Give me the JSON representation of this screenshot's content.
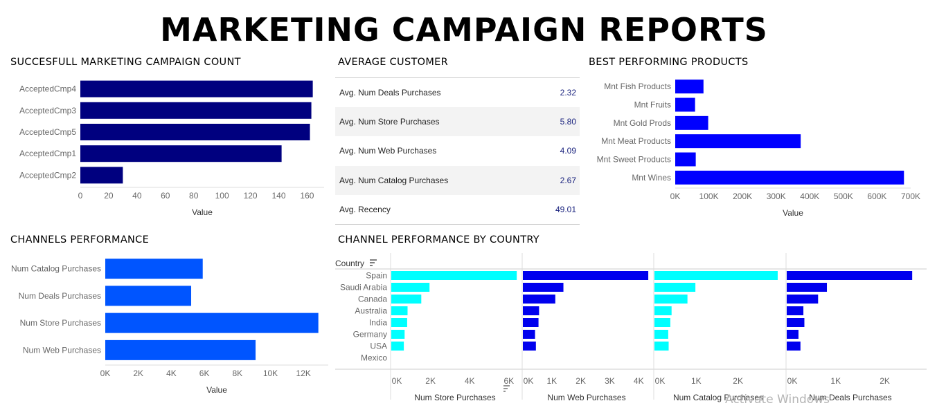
{
  "title": "MARKETING CAMPAIGN REPORTS",
  "sections": {
    "campaign": "SUCCESFULL MARKETING CAMPAIGN COUNT",
    "average": "AVERAGE CUSTOMER",
    "products": "BEST PERFORMING PRODUCTS",
    "channels": "CHANNELS PERFORMANCE",
    "country": "CHANNEL PERFORMANCE BY COUNTRY"
  },
  "average_customer": {
    "rows": [
      {
        "label": "Avg. Num Deals Purchases",
        "value": "2.32"
      },
      {
        "label": "Avg. Num Store Purchases",
        "value": "5.80"
      },
      {
        "label": "Avg. Num Web Purchases",
        "value": "4.09"
      },
      {
        "label": "Avg. Num Catalog Purchases",
        "value": "2.67"
      },
      {
        "label": "Avg. Recency",
        "value": "49.01"
      }
    ]
  },
  "colors": {
    "navy": "#00007f",
    "blue": "#0000ff",
    "mid_blue": "#0055ff",
    "cyan": "#00ffff"
  },
  "watermark": "Activate Windows",
  "chart_data": [
    {
      "type": "bar",
      "orientation": "horizontal",
      "title": "SUCCESFULL MARKETING CAMPAIGN COUNT",
      "categories": [
        "AcceptedCmp4",
        "AcceptedCmp3",
        "AcceptedCmp5",
        "AcceptedCmp1",
        "AcceptedCmp2"
      ],
      "values": [
        164,
        163,
        162,
        142,
        30
      ],
      "xlabel": "Value",
      "xlim": [
        0,
        172
      ],
      "ticks": [
        0,
        20,
        40,
        60,
        80,
        100,
        120,
        140,
        160
      ],
      "tick_labels": [
        "0",
        "20",
        "40",
        "60",
        "80",
        "100",
        "120",
        "140",
        "160"
      ],
      "color": "#00007f"
    },
    {
      "type": "bar",
      "orientation": "horizontal",
      "title": "BEST PERFORMING PRODUCTS",
      "categories": [
        "Mnt Fish Products",
        "Mnt Fruits",
        "Mnt Gold Prods",
        "Mnt Meat Products",
        "Mnt Sweet Products",
        "Mnt Wines"
      ],
      "values": [
        84000,
        59000,
        98000,
        373000,
        61000,
        680000
      ],
      "xlabel": "Value",
      "xlim": [
        0,
        700000
      ],
      "ticks": [
        0,
        100000,
        200000,
        300000,
        400000,
        500000,
        600000,
        700000
      ],
      "tick_labels": [
        "0K",
        "100K",
        "200K",
        "300K",
        "400K",
        "500K",
        "600K",
        "700K"
      ],
      "color": "#0000ff"
    },
    {
      "type": "bar",
      "orientation": "horizontal",
      "title": "CHANNELS PERFORMANCE",
      "categories": [
        "Num Catalog Purchases",
        "Num Deals Purchases",
        "Num Store Purchases",
        "Num Web Purchases"
      ],
      "values": [
        5900,
        5200,
        12900,
        9100
      ],
      "xlabel": "Value",
      "xlim": [
        0,
        13500
      ],
      "ticks": [
        0,
        2000,
        4000,
        6000,
        8000,
        10000,
        12000
      ],
      "tick_labels": [
        "0K",
        "2K",
        "4K",
        "6K",
        "8K",
        "10K",
        "12K"
      ],
      "color": "#0055ff"
    },
    {
      "type": "bar",
      "orientation": "horizontal",
      "title": "CHANNEL PERFORMANCE BY COUNTRY",
      "row_header": "Country",
      "categories": [
        "Spain",
        "Saudi Arabia",
        "Canada",
        "Australia",
        "India",
        "Germany",
        "USA",
        "Mexico"
      ],
      "series": [
        {
          "name": "Num Store Purchases",
          "values": [
            6400,
            1950,
            1530,
            830,
            810,
            680,
            640,
            0
          ],
          "xlim": [
            0,
            6500
          ],
          "ticks": [
            0,
            2000,
            4000,
            6000
          ],
          "tick_labels": [
            "0K",
            "2K",
            "4K",
            "6K"
          ],
          "color": "#00ffff"
        },
        {
          "name": "Num Web Purchases",
          "values": [
            4330,
            1400,
            1120,
            560,
            540,
            420,
            450,
            0
          ],
          "xlim": [
            0,
            4400
          ],
          "ticks": [
            0,
            1000,
            2000,
            3000,
            4000
          ],
          "tick_labels": [
            "0K",
            "1K",
            "2K",
            "3K",
            "4K"
          ],
          "color": "#0000ee"
        },
        {
          "name": "Num Catalog Purchases",
          "values": [
            2950,
            980,
            790,
            410,
            380,
            330,
            340,
            0
          ],
          "xlim": [
            0,
            3050
          ],
          "ticks": [
            0,
            1000,
            2000
          ],
          "tick_labels": [
            "0K",
            "1K",
            "2K"
          ],
          "color": "#00ffff"
        },
        {
          "name": "Num Deals Purchases",
          "values": [
            2560,
            820,
            640,
            340,
            360,
            240,
            280,
            0
          ],
          "xlim": [
            0,
            2600
          ],
          "ticks": [
            0,
            1000,
            2000
          ],
          "tick_labels": [
            "0K",
            "1K",
            "2K"
          ],
          "color": "#0000ee"
        }
      ]
    }
  ]
}
